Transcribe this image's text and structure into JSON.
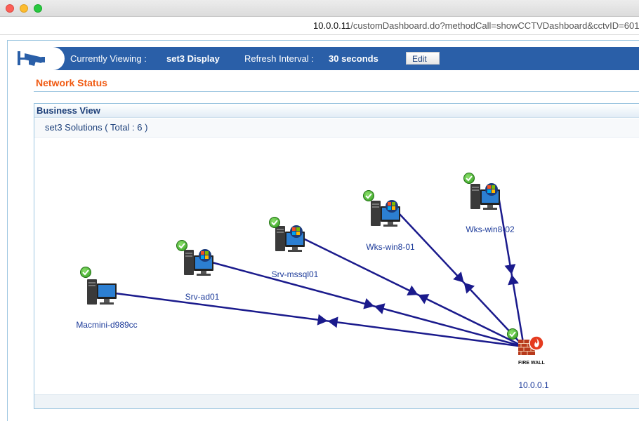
{
  "browser": {
    "url_host": "10.0.0.11",
    "url_path": "/customDashboard.do?methodCall=showCCTVDashboard&cctvID=601&"
  },
  "header": {
    "viewing_label": "Currently Viewing :",
    "viewing_value": "set3 Display",
    "refresh_label": "Refresh Interval :",
    "refresh_value": "30 seconds",
    "edit_label": "Edit",
    "icon": "cctv-camera-icon"
  },
  "section": {
    "title": "Network Status"
  },
  "business_view": {
    "title": "Business View",
    "subtitle": "set3 Solutions ( Total : 6 )"
  },
  "diagram": {
    "hub": {
      "name": "10.0.0.1",
      "icon_text": "FIRE WALL",
      "type": "firewall",
      "status": "up"
    },
    "nodes": [
      {
        "name": "Macmini-d989cc",
        "type": "mac",
        "status": "up"
      },
      {
        "name": "Srv-ad01",
        "type": "windows",
        "status": "up"
      },
      {
        "name": "Srv-mssql01",
        "type": "windows",
        "status": "up"
      },
      {
        "name": "Wks-win8-01",
        "type": "windows",
        "status": "up"
      },
      {
        "name": "Wks-win8-02",
        "type": "windows",
        "status": "up"
      }
    ],
    "link_color": "#1a1a8c",
    "status_color": "#3bb12a"
  }
}
